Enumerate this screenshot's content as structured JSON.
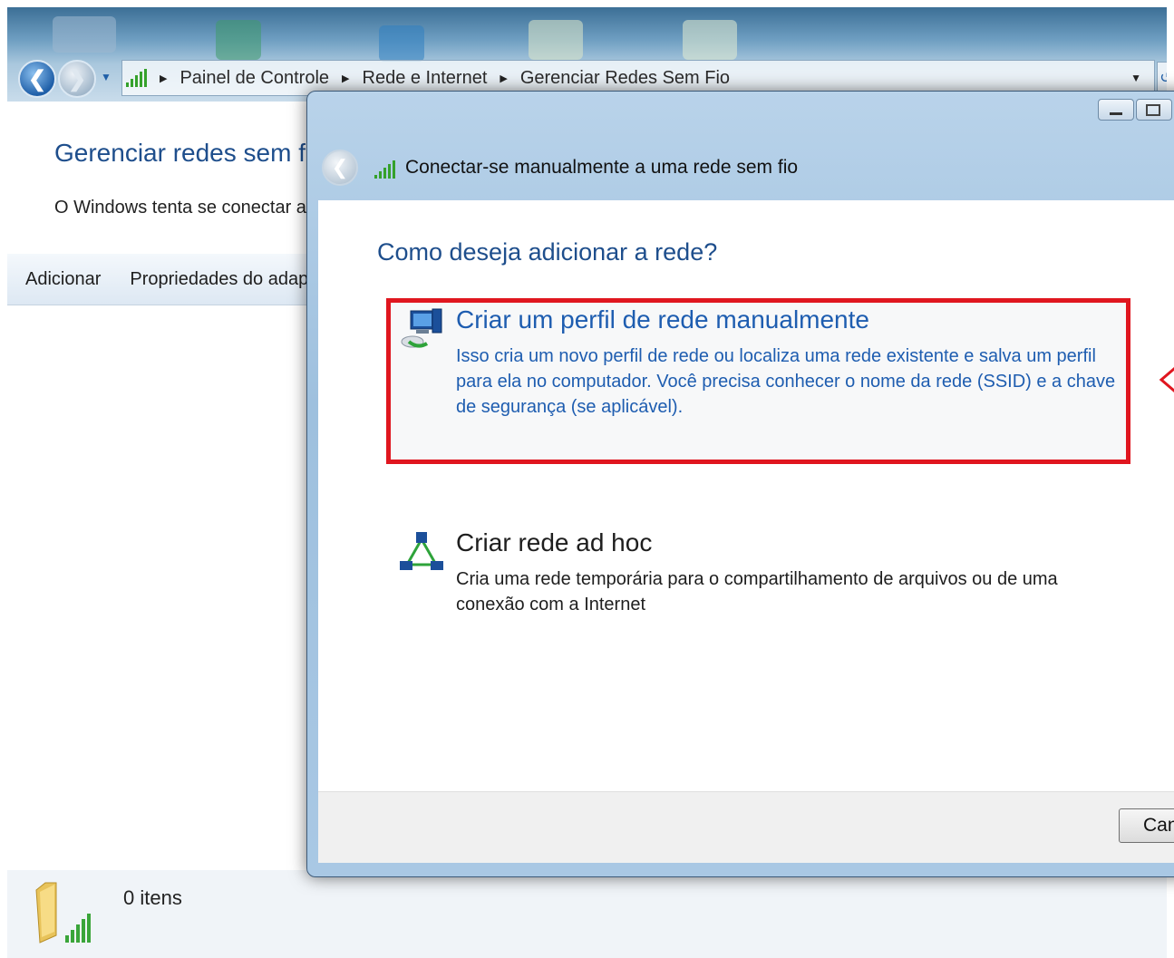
{
  "explorer": {
    "breadcrumb": [
      "Painel de Controle",
      "Rede e Internet",
      "Gerenciar Redes Sem Fio"
    ],
    "page_title": "Gerenciar redes sem fio",
    "page_desc": "O Windows tenta se conectar a",
    "toolbar": {
      "add_label": "Adicionar",
      "adapter_label": "Propriedades do adap"
    },
    "status": {
      "item_count": "0 itens"
    }
  },
  "dialog": {
    "title": "Conectar-se manualmente a uma rede sem fio",
    "question": "Como deseja adicionar a rede?",
    "options": [
      {
        "title": "Criar um perfil de rede manualmente",
        "description": "Isso cria um novo perfil de rede ou localiza uma rede existente e salva um perfil para ela no computador. Você precisa conhecer o nome da rede (SSID) e a chave de segurança (se aplicável).",
        "icon": "network-computer-icon"
      },
      {
        "title": "Criar rede ad hoc",
        "description": "Cria uma rede temporária para o compartilhamento de arquivos ou de uma conexão com a Internet",
        "icon": "adhoc-network-icon"
      }
    ],
    "cancel_label": "Cancelar"
  },
  "colors": {
    "highlight": "#e0161f",
    "link_blue": "#1e5db0",
    "heading_blue": "#1e4e8c"
  }
}
